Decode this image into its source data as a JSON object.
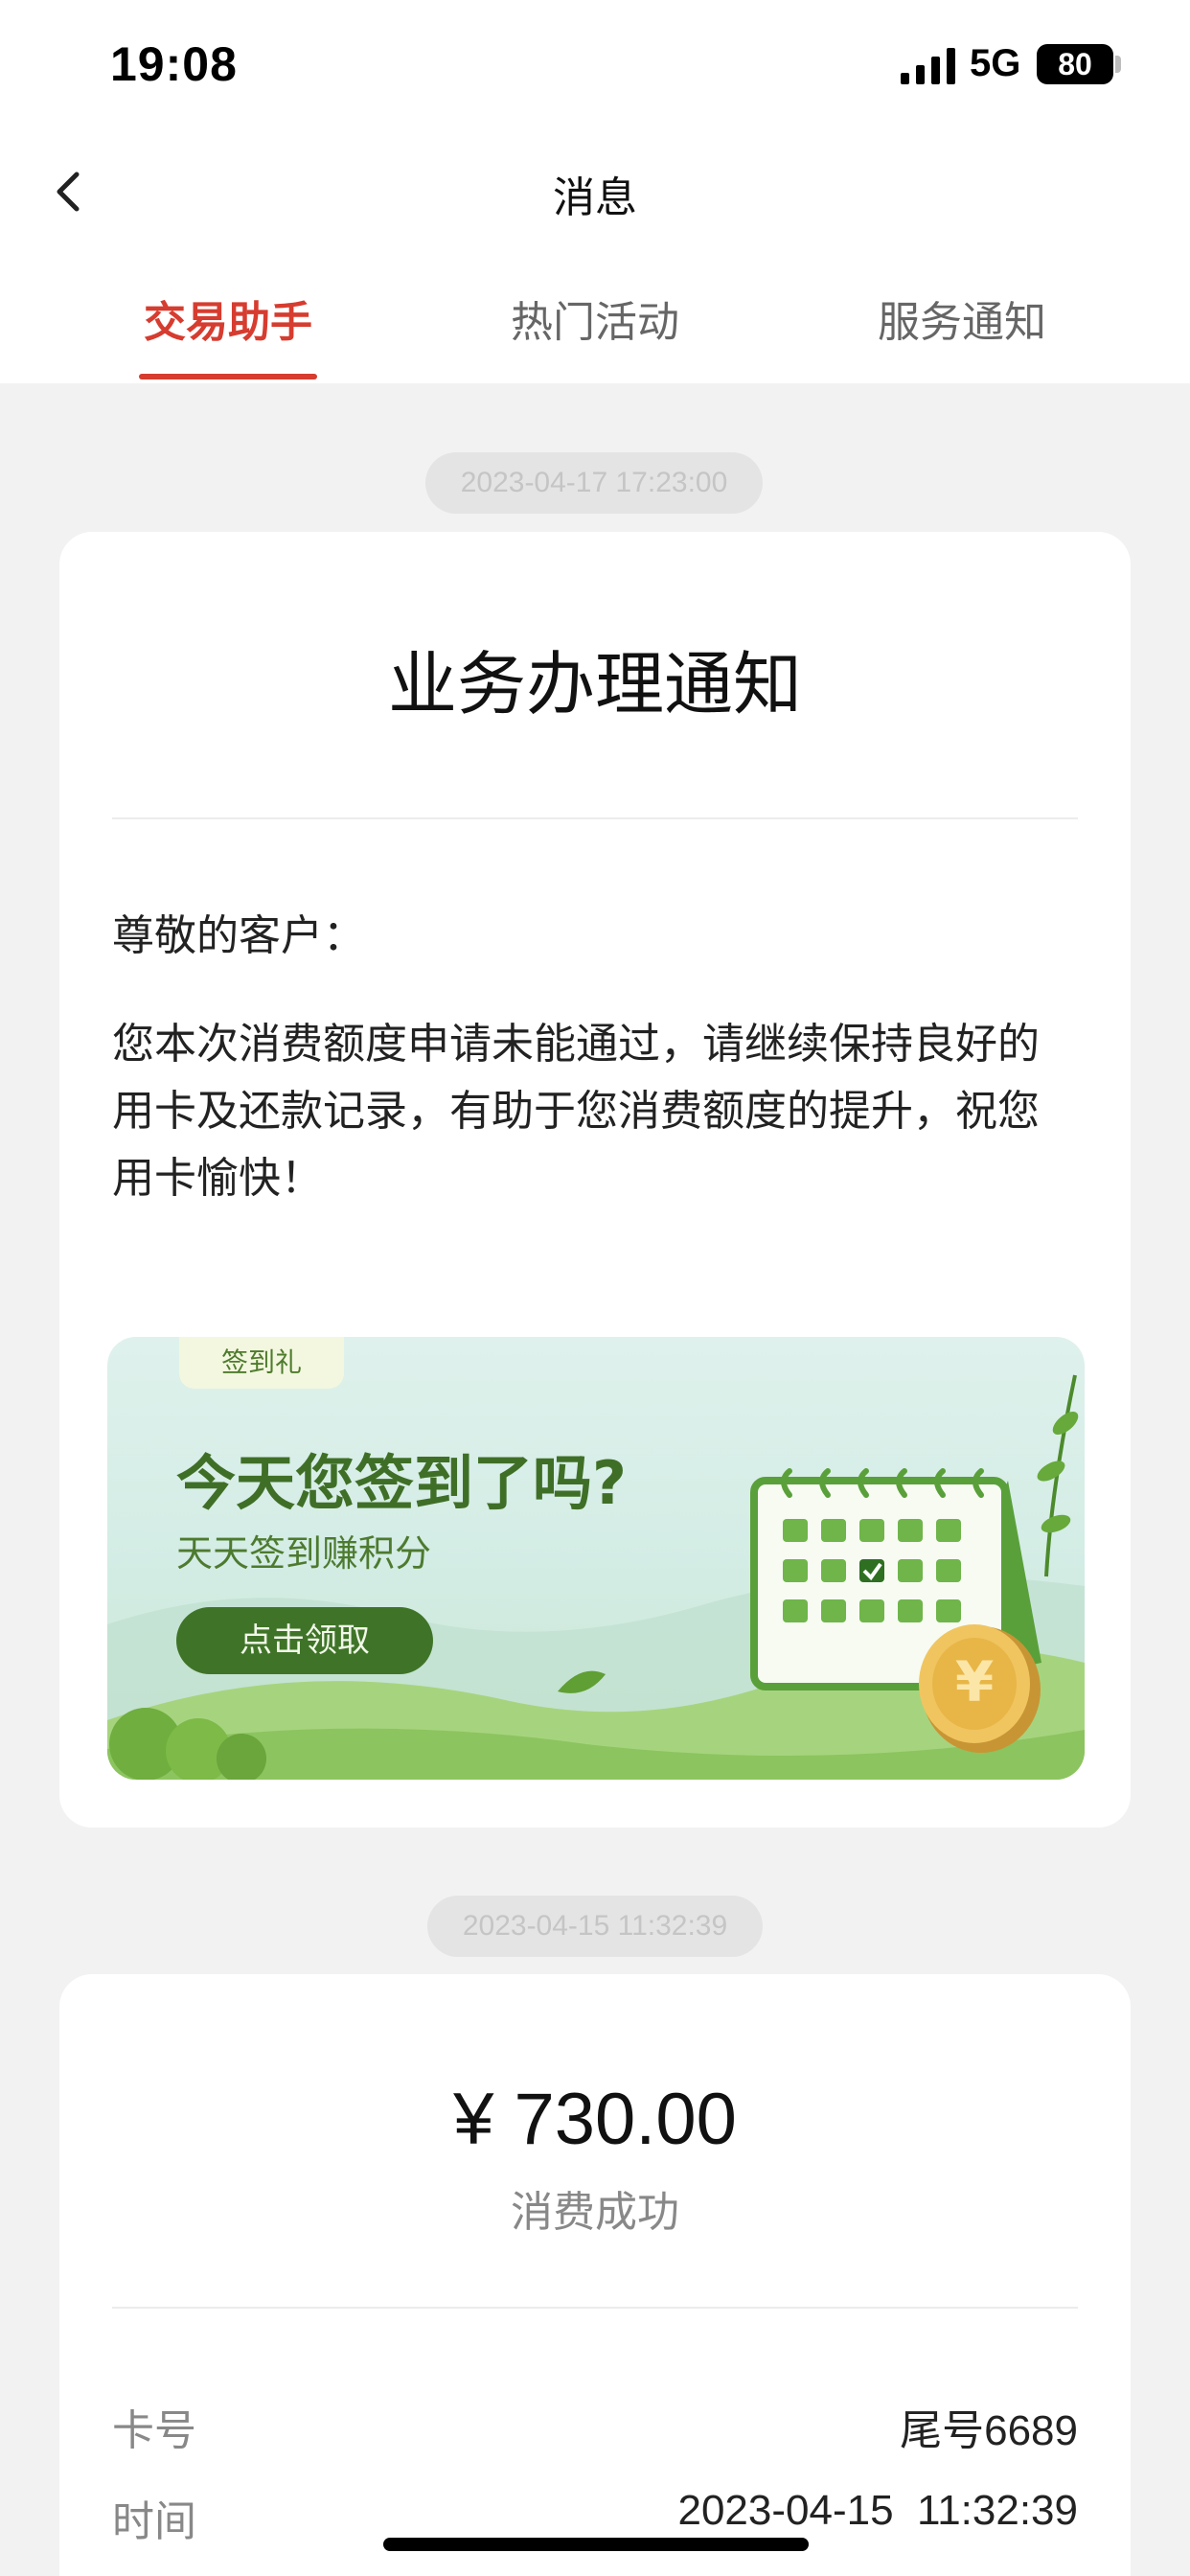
{
  "status_bar": {
    "time": "19:08",
    "network": "5G",
    "battery": "80",
    "icons": [
      "signal-icon",
      "battery-icon"
    ]
  },
  "nav": {
    "title": "消息",
    "back_icon": "chevron-left-icon"
  },
  "tabs": [
    {
      "label": "交易助手",
      "active": true
    },
    {
      "label": "热门活动",
      "active": false
    },
    {
      "label": "服务通知",
      "active": false
    }
  ],
  "colors": {
    "accent": "#d63c2f",
    "banner_green": "#3f7428",
    "background": "#f2f2f2"
  },
  "messages": [
    {
      "timestamp": "2023-04-17 17:23:00",
      "title": "业务办理通知",
      "greeting": "尊敬的客户：",
      "body": "您本次消费额度申请未能通过，请继续保持良好的用卡及还款记录，有助于您消费额度的提升，祝您用卡愉快！",
      "banner": {
        "tag": "签到礼",
        "headline": "今天您签到了吗?",
        "subtitle": "天天签到赚积分",
        "button": "点击领取",
        "icons": [
          "calendar-icon",
          "coin-icon",
          "leaf-icon"
        ]
      }
    },
    {
      "timestamp": "2023-04-15 11:32:39",
      "amount": "¥ 730.00",
      "status": "消费成功",
      "details": [
        {
          "label": "卡号",
          "value": "尾号6689"
        },
        {
          "label": "时间",
          "value": "2023-04-15  11:32:39"
        }
      ]
    }
  ]
}
